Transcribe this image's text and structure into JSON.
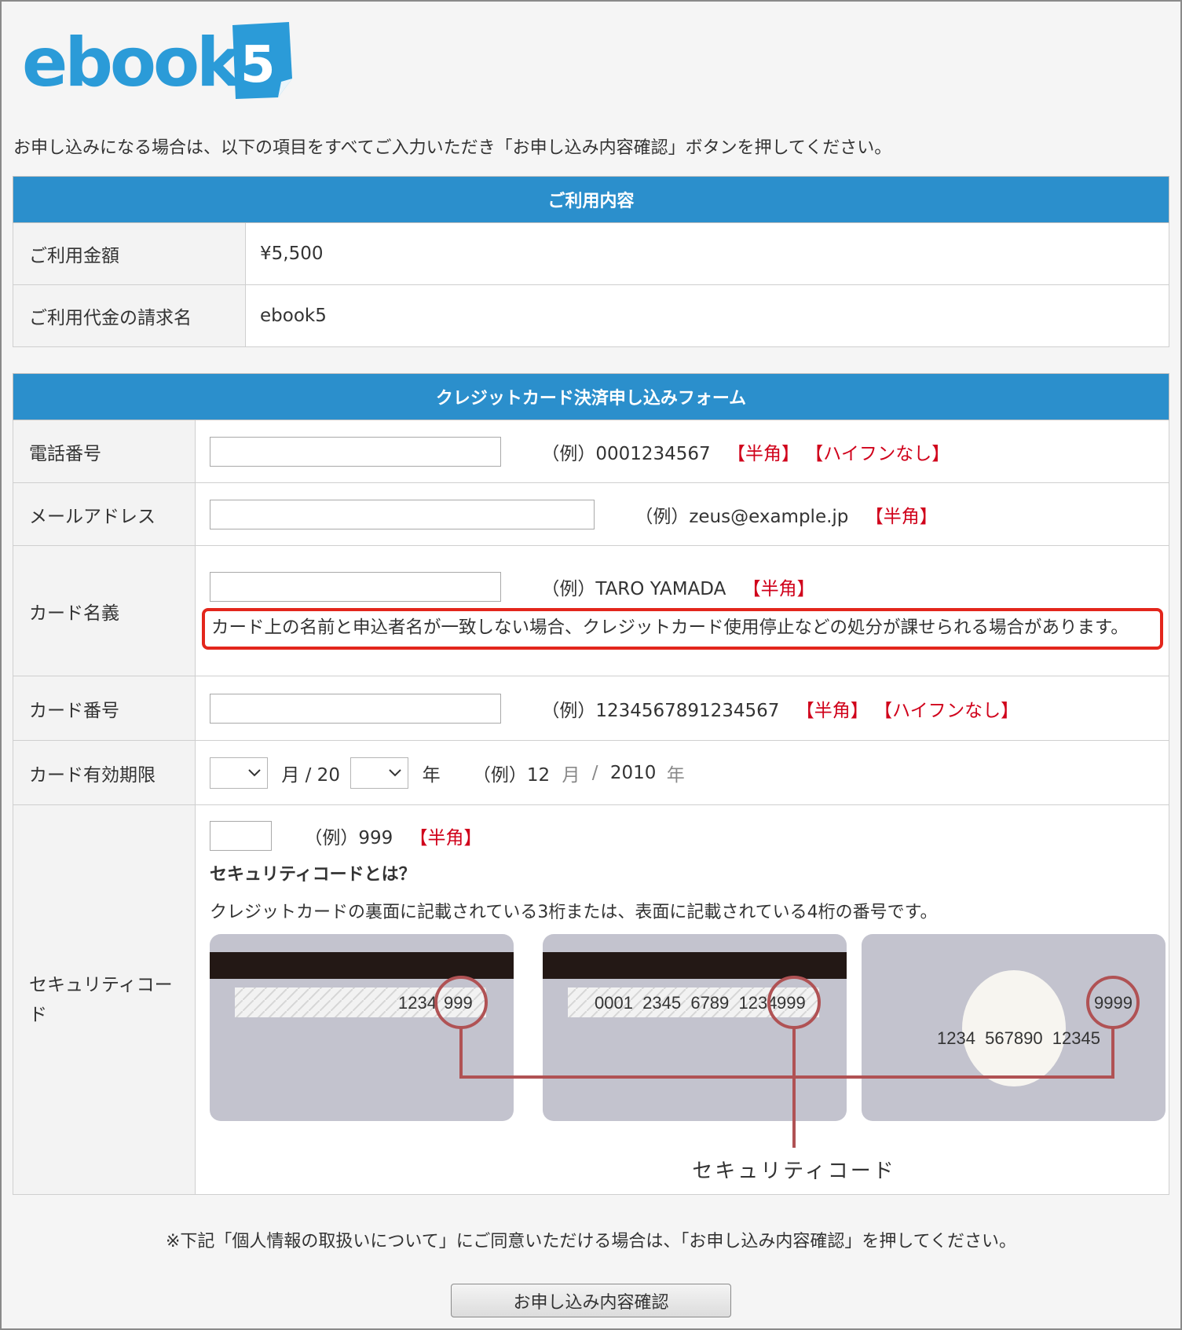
{
  "logo": {
    "text": "ebook",
    "number": "5",
    "color": "#2b9bd8"
  },
  "intro": "お申し込みになる場合は、以下の項目をすべてご入力いただき「お申し込み内容確認」ボタンを押してください。",
  "usage": {
    "header": "ご利用内容",
    "rows": [
      {
        "label": "ご利用金額",
        "value": "¥5,500"
      },
      {
        "label": "ご利用代金の請求名",
        "value": "ebook5"
      }
    ]
  },
  "form": {
    "header": "クレジットカード決済申し込みフォーム",
    "phone": {
      "label": "電話番号",
      "example": "（例）0001234567",
      "tag1": "【半角】",
      "tag2": "【ハイフンなし】"
    },
    "email": {
      "label": "メールアドレス",
      "example": "（例）zeus@example.jp",
      "tag1": "【半角】"
    },
    "card_name": {
      "label": "カード名義",
      "example": "（例）TARO YAMADA",
      "tag1": "【半角】",
      "notice": "カード上の名前と申込者名が一致しない場合、クレジットカード使用停止などの処分が課せられる場合があります。"
    },
    "card_number": {
      "label": "カード番号",
      "example": "（例）1234567891234567",
      "tag1": "【半角】",
      "tag2": "【ハイフンなし】"
    },
    "expiry": {
      "label": "カード有効期限",
      "month_unit": "月 / 20",
      "year_unit": "年",
      "example_prefix": "（例）12",
      "example_month": "月",
      "example_sep": "/",
      "example_year": "2010",
      "example_year_unit": "年"
    },
    "security": {
      "label": "セキュリティコード",
      "example": "（例）999",
      "tag1": "【半角】",
      "title": "セキュリティコードとは？",
      "description": "クレジットカードの裏面に記載されている3桁または、表面に記載されている4桁の番号です。",
      "card1_digits": "1234",
      "card1_code": "999",
      "card2_digits": "0001  2345  6789  1234",
      "card2_code": "999",
      "card3_number": "1234  567890  12345",
      "card3_code": "9999",
      "diagram_caption": "セキュリティコード"
    }
  },
  "bottom_note": "※下記「個人情報の取扱いについて」にご同意いただける場合は、「お申し込み内容確認」を押してください。",
  "confirm_button": "お申し込み内容確認"
}
